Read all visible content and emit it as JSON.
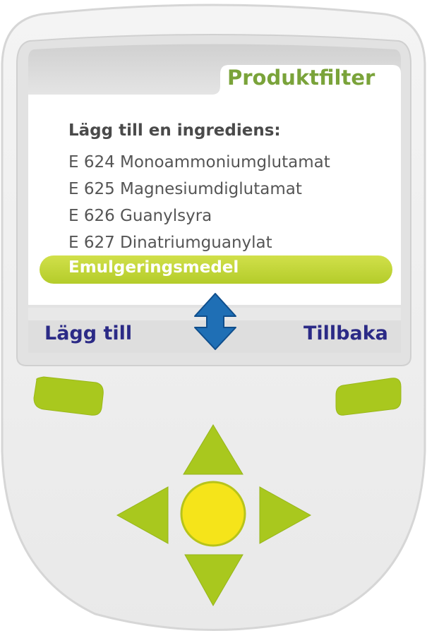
{
  "screen": {
    "title": "Produktfilter",
    "heading": "Lägg till en ingrediens:",
    "items": [
      {
        "label": "E 624 Monoammoniumglutamat",
        "selected": false
      },
      {
        "label": "E 625 Magnesiumdiglutamat",
        "selected": false
      },
      {
        "label": "E 626 Guanylsyra",
        "selected": false
      },
      {
        "label": "E 627 Dinatriumguanylat",
        "selected": false
      },
      {
        "label": "Emulgeringsmedel",
        "selected": true
      }
    ],
    "scroll_icon": "up-down-arrow-icon"
  },
  "softkeys": {
    "left_label": "Lägg till",
    "right_label": "Tillbaka"
  },
  "dpad": {
    "up": "triangle-up-icon",
    "down": "triangle-down-icon",
    "left": "triangle-left-icon",
    "right": "triangle-right-icon",
    "center": "circle-icon"
  },
  "colors": {
    "accent_green": "#a9c81e",
    "title_green": "#7aa33a",
    "navy": "#2b2a86",
    "arrow_blue": "#1f6fb5",
    "center_yellow": "#f5e41a",
    "selection_bar": "#c5d93e"
  }
}
